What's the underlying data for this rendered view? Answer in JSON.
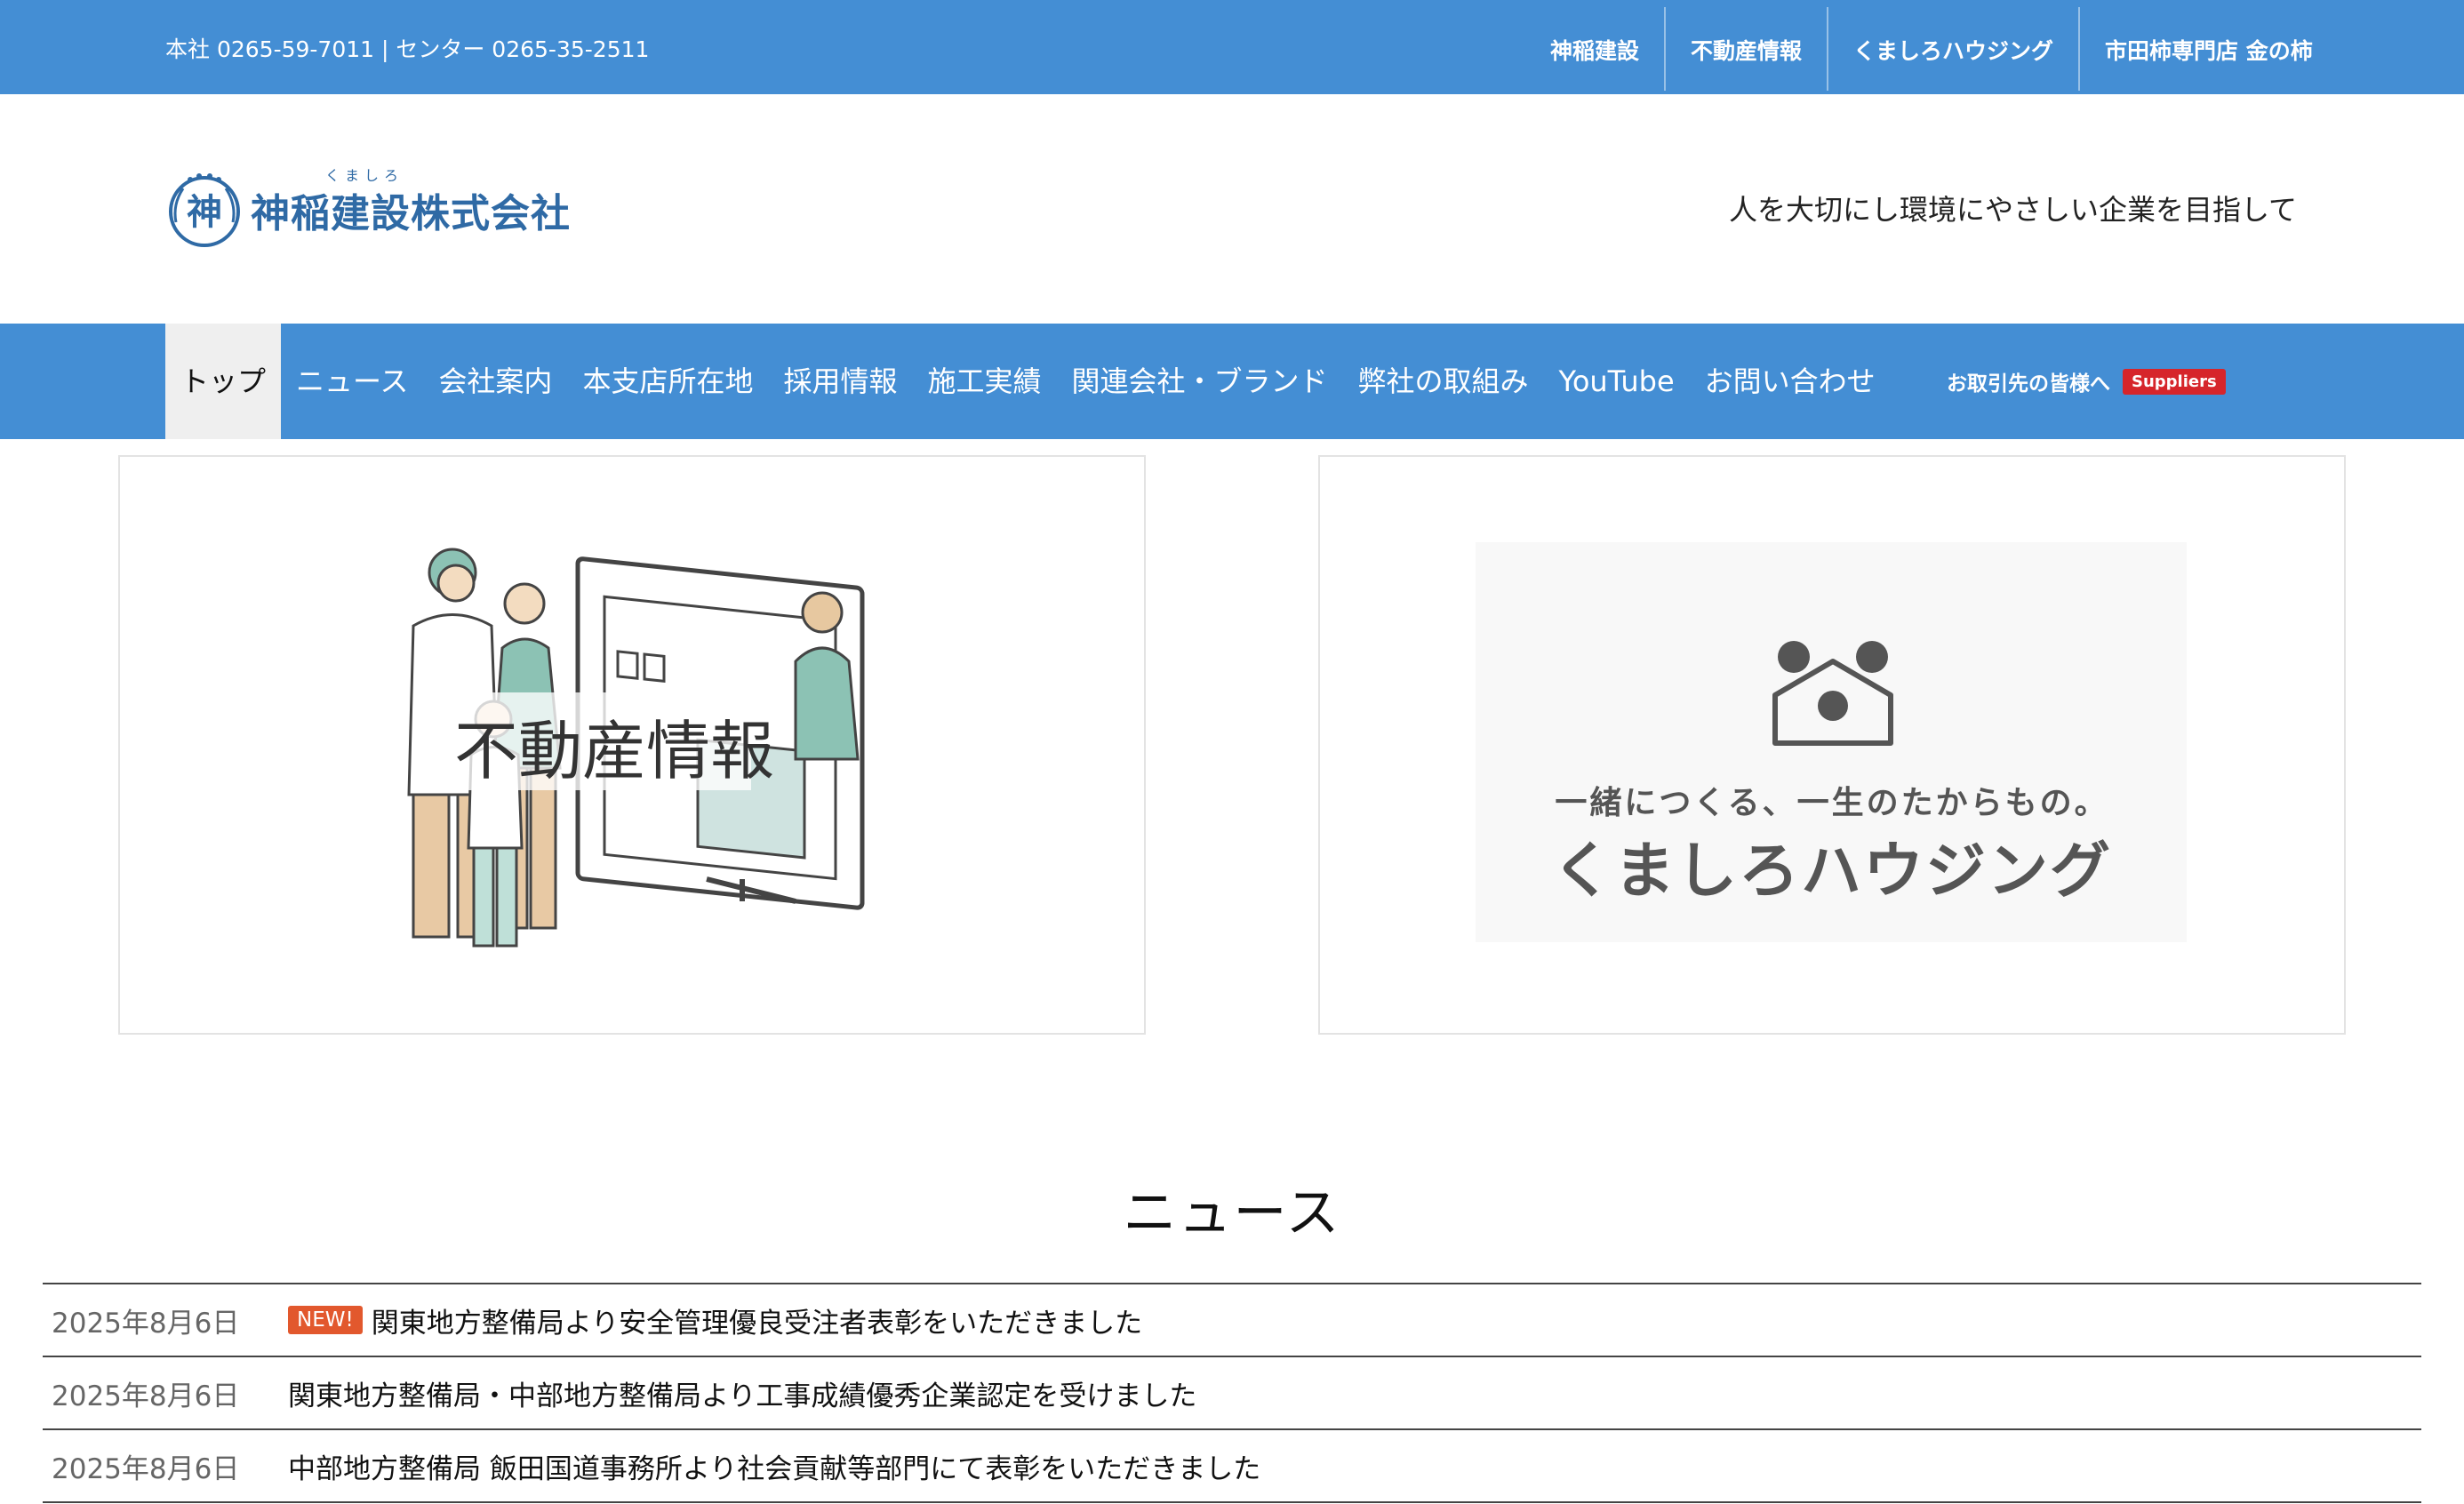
{
  "topbar": {
    "phone": "本社 0265-59-7011 | センター 0265-35-2511",
    "links": [
      "神稲建設",
      "不動産情報",
      "くましろハウジング",
      "市田柿専門店 金の柿"
    ]
  },
  "header": {
    "logo_mark": "神",
    "logo_ruby": "くましろ",
    "logo_text": "神稲建設株式会社",
    "tagline": "人を大切にし環境にやさしい企業を目指して"
  },
  "nav": {
    "items": [
      "トップ",
      "ニュース",
      "会社案内",
      "本支店所在地",
      "採用情報",
      "施工実績",
      "関連会社・ブランド",
      "弊社の取組み",
      "YouTube",
      "お問い合わせ"
    ],
    "active_index": 0,
    "suppliers_label": "お取引先の皆様へ",
    "suppliers_badge": "Suppliers"
  },
  "banners": {
    "left_title": "不動産情報",
    "right_tagline": "一緒につくる、一生のたからもの。",
    "right_brand": "くましろハウジング"
  },
  "news": {
    "title": "ニュース",
    "new_badge": "NEW!",
    "items": [
      {
        "date": "2025年8月6日",
        "text": "関東地方整備局より安全管理優良受注者表彰をいただきました",
        "is_new": true
      },
      {
        "date": "2025年8月6日",
        "text": "関東地方整備局・中部地方整備局より工事成績優秀企業認定を受けました",
        "is_new": false
      },
      {
        "date": "2025年8月6日",
        "text": "中部地方整備局 飯田国道事務所より社会貢献等部門にて表彰をいただきました",
        "is_new": false
      }
    ]
  },
  "colors": {
    "primary": "#448ed4",
    "logo": "#2f6aa5",
    "badge_red": "#d6252b",
    "new_orange": "#e2582d"
  }
}
